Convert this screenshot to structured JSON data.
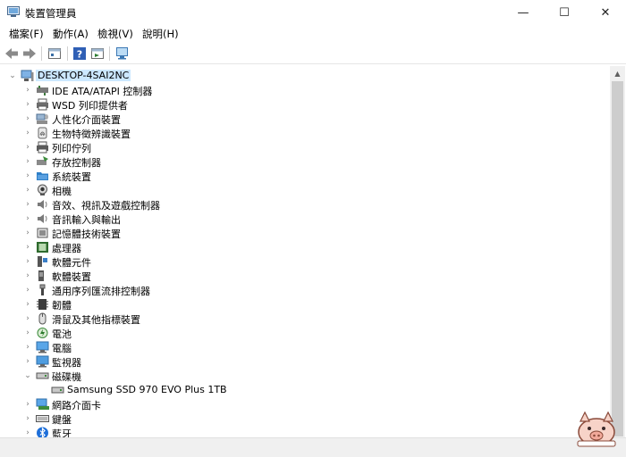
{
  "window": {
    "title": "裝置管理員",
    "controls": {
      "minimize": "—",
      "maximize": "☐",
      "close": "✕"
    }
  },
  "menu": [
    {
      "label": "檔案(F)"
    },
    {
      "label": "動作(A)"
    },
    {
      "label": "檢視(V)"
    },
    {
      "label": "說明(H)"
    }
  ],
  "toolbar": {
    "buttons": [
      "back-arrow-icon",
      "forward-arrow-icon",
      "properties-icon",
      "help-icon",
      "update-driver-icon",
      "scan-hardware-icon"
    ]
  },
  "tree": {
    "root": {
      "label": "DESKTOP-4SAI2NC",
      "expanded": true,
      "icon": "computer-icon"
    },
    "categories": [
      {
        "label": "IDE ATA/ATAPI 控制器",
        "icon": "ide-controller-icon"
      },
      {
        "label": "WSD 列印提供者",
        "icon": "printer-icon"
      },
      {
        "label": "人性化介面裝置",
        "icon": "hid-icon"
      },
      {
        "label": "生物特徵辨識裝置",
        "icon": "fingerprint-icon"
      },
      {
        "label": "列印佇列",
        "icon": "print-queue-icon"
      },
      {
        "label": "存放控制器",
        "icon": "storage-controller-icon"
      },
      {
        "label": "系統裝置",
        "icon": "system-folder-icon"
      },
      {
        "label": "相機",
        "icon": "camera-icon"
      },
      {
        "label": "音效、視訊及遊戲控制器",
        "icon": "speaker-icon"
      },
      {
        "label": "音訊輸入與輸出",
        "icon": "audio-io-icon"
      },
      {
        "label": "記憶體技術裝置",
        "icon": "memory-icon"
      },
      {
        "label": "處理器",
        "icon": "processor-icon"
      },
      {
        "label": "軟體元件",
        "icon": "software-component-icon"
      },
      {
        "label": "軟體裝置",
        "icon": "software-device-icon"
      },
      {
        "label": "通用序列匯流排控制器",
        "icon": "usb-icon"
      },
      {
        "label": "韌體",
        "icon": "firmware-icon"
      },
      {
        "label": "滑鼠及其他指標裝置",
        "icon": "mouse-icon"
      },
      {
        "label": "電池",
        "icon": "battery-icon"
      },
      {
        "label": "電腦",
        "icon": "computer-monitor-icon"
      },
      {
        "label": "監視器",
        "icon": "monitor-icon"
      },
      {
        "label": "磁碟機",
        "icon": "disk-drive-icon",
        "expanded": true,
        "children": [
          {
            "label": "Samsung SSD 970 EVO Plus 1TB",
            "icon": "disk-icon"
          }
        ]
      },
      {
        "label": "網路介面卡",
        "icon": "network-adapter-icon"
      },
      {
        "label": "鍵盤",
        "icon": "keyboard-icon"
      },
      {
        "label": "藍牙",
        "icon": "bluetooth-icon"
      }
    ],
    "expand_glyph": "›",
    "collapse_glyph": "⌄"
  },
  "colors": {
    "selection": "#cce8ff",
    "accent": "#0078d7",
    "scroll_track": "#f0f0f0",
    "scroll_thumb": "#cdcdcd"
  }
}
